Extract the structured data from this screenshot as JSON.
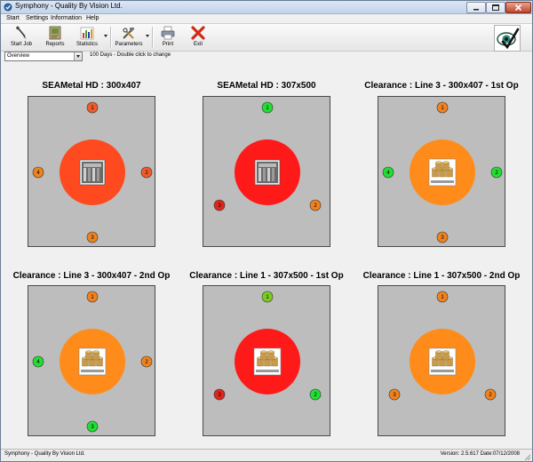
{
  "window": {
    "title": "Symphony - Quality By Vision Ltd.",
    "controls": [
      "minimize-icon",
      "maximize-icon",
      "close-icon"
    ]
  },
  "menu": [
    "Start",
    "Settings",
    "Information",
    "Help"
  ],
  "toolbar": {
    "buttons": [
      {
        "label": "Start Job",
        "icon": "start-job-icon"
      },
      {
        "label": "Reports",
        "icon": "reports-icon"
      },
      {
        "label": "Statistics",
        "icon": "statistics-icon"
      },
      {
        "label": "Parameters",
        "icon": "parameters-icon"
      },
      {
        "label": "Print",
        "icon": "printer-icon"
      },
      {
        "label": "Exit",
        "icon": "exit-icon"
      }
    ],
    "brand_icon": "eye-checkmark-logo"
  },
  "view": {
    "selected": "Overview",
    "hint": "100 Days - Double click to change"
  },
  "colors": {
    "red": "#ff1a1a",
    "red_orange": "#ff4a1f",
    "orange": "#ff8c1a",
    "dot_red": "#e0261c",
    "dot_orange": "#f0821e",
    "dot_green": "#22dd33",
    "panel_gray": "#bdbdbd"
  },
  "panels": [
    {
      "title": "SEAMetal HD : 300x407",
      "center_color": "#ff4a1f",
      "image": "machine-photo",
      "dots": [
        {
          "label": "1",
          "color": "#f05a28",
          "pos": "top"
        },
        {
          "label": "2",
          "color": "#f05a28",
          "pos": "right"
        },
        {
          "label": "3",
          "color": "#f0821e",
          "pos": "bottom"
        },
        {
          "label": "4",
          "color": "#f0821e",
          "pos": "left"
        }
      ]
    },
    {
      "title": "SEAMetal HD : 307x500",
      "center_color": "#ff1a1a",
      "image": "machine-photo",
      "dots": [
        {
          "label": "1",
          "color": "#22dd33",
          "pos": "top"
        },
        {
          "label": "2",
          "color": "#f0821e",
          "pos": "lower-right"
        },
        {
          "label": "3",
          "color": "#e0261c",
          "pos": "lower-left"
        }
      ]
    },
    {
      "title": "Clearance : Line 3 - 300x407 - 1st Op",
      "center_color": "#ff8c1a",
      "image": "cans-photo",
      "dots": [
        {
          "label": "1",
          "color": "#f0821e",
          "pos": "top"
        },
        {
          "label": "2",
          "color": "#22dd33",
          "pos": "right"
        },
        {
          "label": "3",
          "color": "#f0821e",
          "pos": "bottom"
        },
        {
          "label": "4",
          "color": "#22dd33",
          "pos": "left"
        }
      ]
    },
    {
      "title": "Clearance : Line 3 - 300x407 - 2nd Op",
      "center_color": "#ff8c1a",
      "image": "cans-photo",
      "dots": [
        {
          "label": "1",
          "color": "#f0821e",
          "pos": "top"
        },
        {
          "label": "2",
          "color": "#f0821e",
          "pos": "right"
        },
        {
          "label": "3",
          "color": "#22dd33",
          "pos": "bottom"
        },
        {
          "label": "4",
          "color": "#22dd33",
          "pos": "left"
        }
      ]
    },
    {
      "title": "Clearance : Line 1 - 307x500 - 1st Op",
      "center_color": "#ff1a1a",
      "image": "cans-photo",
      "dots": [
        {
          "label": "1",
          "color": "#7acc1e",
          "pos": "top"
        },
        {
          "label": "2",
          "color": "#22dd33",
          "pos": "lower-right"
        },
        {
          "label": "3",
          "color": "#e0261c",
          "pos": "lower-left"
        }
      ]
    },
    {
      "title": "Clearance : Line 1 - 307x500 - 2nd Op",
      "center_color": "#ff8c1a",
      "image": "cans-photo",
      "dots": [
        {
          "label": "1",
          "color": "#f0821e",
          "pos": "top"
        },
        {
          "label": "2",
          "color": "#f0821e",
          "pos": "lower-right"
        },
        {
          "label": "3",
          "color": "#f0821e",
          "pos": "lower-left"
        }
      ]
    }
  ],
  "status": {
    "left": "Symphony - Quality By Vision Ltd.",
    "right": "Version: 2.5.617  Date:07/12/2008"
  }
}
